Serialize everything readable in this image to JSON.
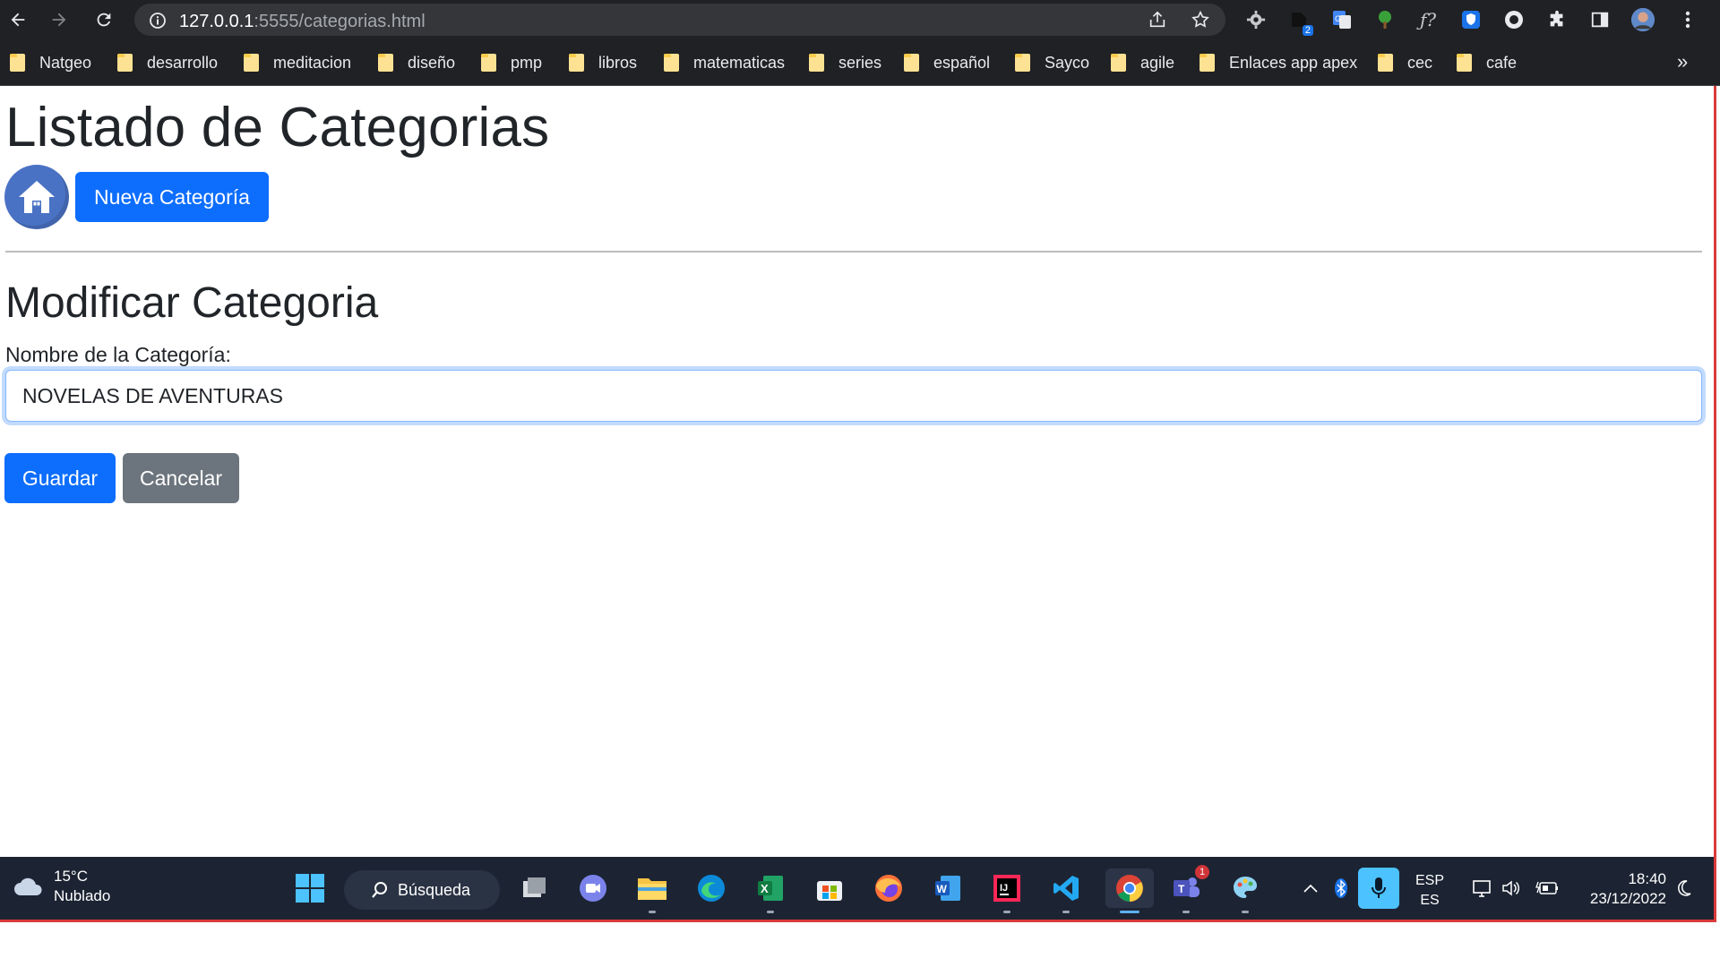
{
  "browser": {
    "url_host": "127.0.0.1",
    "url_path": ":5555/categorias.html",
    "extension_badge": "2",
    "bookmarks": [
      "Natgeo",
      "desarrollo",
      "meditacion",
      "diseño",
      "pmp",
      "libros",
      "matematicas",
      "series",
      "español",
      "Sayco",
      "agile",
      "Enlaces app apex",
      "cec",
      "cafe"
    ],
    "bookmarks_more": "»"
  },
  "page": {
    "title": "Listado de Categorias",
    "new_category_label": "Nueva Categoría",
    "form_title": "Modificar Categoria",
    "name_label": "Nombre de la Categoría:",
    "name_value": "NOVELAS DE AVENTURAS",
    "save_label": "Guardar",
    "cancel_label": "Cancelar"
  },
  "taskbar": {
    "weather_temp": "15°C",
    "weather_desc": "Nublado",
    "search_label": "Búsqueda",
    "teams_badge": "1",
    "lang_primary": "ESP",
    "lang_secondary": "ES",
    "time": "18:40",
    "date": "23/12/2022"
  },
  "colors": {
    "primary": "#0d6efd",
    "secondary": "#6c757d",
    "browser_chrome": "#202124",
    "taskbar": "#1c2433"
  }
}
